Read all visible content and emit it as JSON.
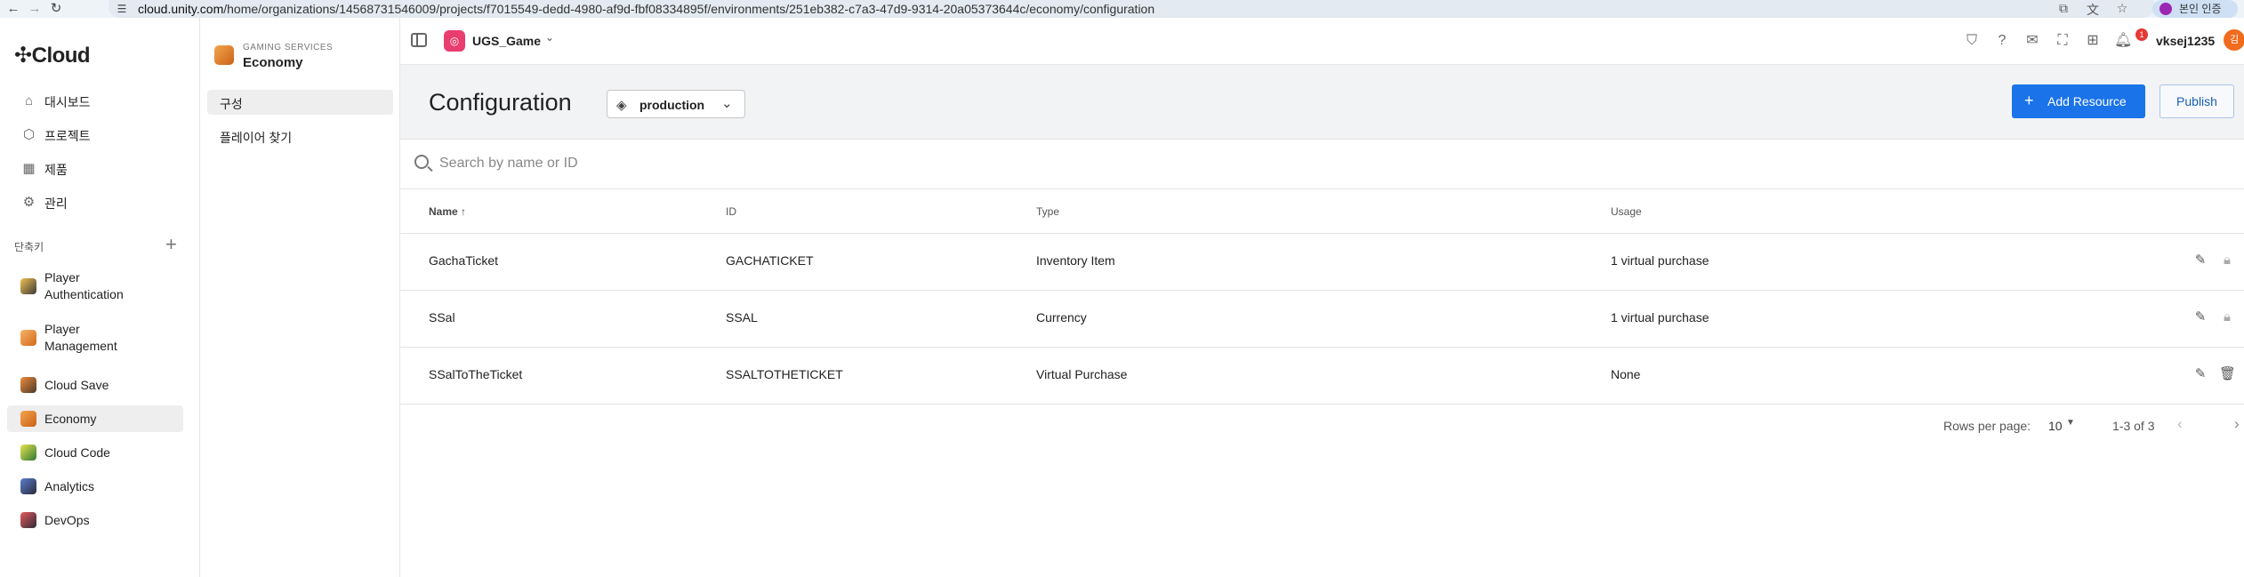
{
  "browser": {
    "url_host": "cloud.unity.com",
    "url_path": "/home/organizations/14568731546009/projects/f7015549-dedd-4980-af9d-fbf08334895f/environments/251eb382-c7a3-47d9-9314-20a05373644c/economy/configuration",
    "verify_label": "본인 인증"
  },
  "sidebar": {
    "logo": "Cloud",
    "nav": [
      {
        "label": "대시보드",
        "icon": "home-icon"
      },
      {
        "label": "프로젝트",
        "icon": "cube-outline-icon"
      },
      {
        "label": "제품",
        "icon": "grid-icon"
      },
      {
        "label": "관리",
        "icon": "gear-icon"
      }
    ],
    "shortcuts_label": "단축키",
    "products": [
      {
        "label": "Player Authentication",
        "color": "#e8a33d"
      },
      {
        "label": "Player Management",
        "color": "#f08a2c"
      },
      {
        "label": "Cloud Save",
        "color": "#e86a1c"
      },
      {
        "label": "Economy",
        "color": "#e8862c"
      },
      {
        "label": "Cloud Code",
        "color": "#c9c92c"
      },
      {
        "label": "Analytics",
        "color": "#3a5ba8"
      },
      {
        "label": "DevOps",
        "color": "#d63a3a"
      }
    ],
    "active_product": "Economy"
  },
  "subsidebar": {
    "kicker": "GAMING SERVICES",
    "title": "Economy",
    "items": [
      "구성",
      "플레이어 찾기"
    ],
    "active": "구성"
  },
  "topbar": {
    "project_name": "UGS_Game",
    "notification_count": "1",
    "username": "vksej1235",
    "avatar_initial": "김"
  },
  "page": {
    "title": "Configuration",
    "environment": "production",
    "add_resource_label": "Add Resource",
    "publish_label": "Publish"
  },
  "search": {
    "placeholder": "Search by name or ID"
  },
  "table": {
    "columns": [
      "Name",
      "ID",
      "Type",
      "Usage"
    ],
    "rows": [
      {
        "name": "GachaTicket",
        "id": "GACHATICKET",
        "type": "Inventory Item",
        "usage": "1 virtual purchase",
        "action": "lock"
      },
      {
        "name": "SSal",
        "id": "SSAL",
        "type": "Currency",
        "usage": "1 virtual purchase",
        "action": "lock"
      },
      {
        "name": "SSalToTheTicket",
        "id": "SSALTOTHETICKET",
        "type": "Virtual Purchase",
        "usage": "None",
        "action": "delete"
      }
    ]
  },
  "pagination": {
    "rows_per_page_label": "Rows per page:",
    "rows_per_page": "10",
    "range": "1-3 of 3"
  },
  "colors": {
    "accent": "#1a73e8",
    "project_badge": "#e93d6e",
    "avatar": "#f06b1e"
  }
}
